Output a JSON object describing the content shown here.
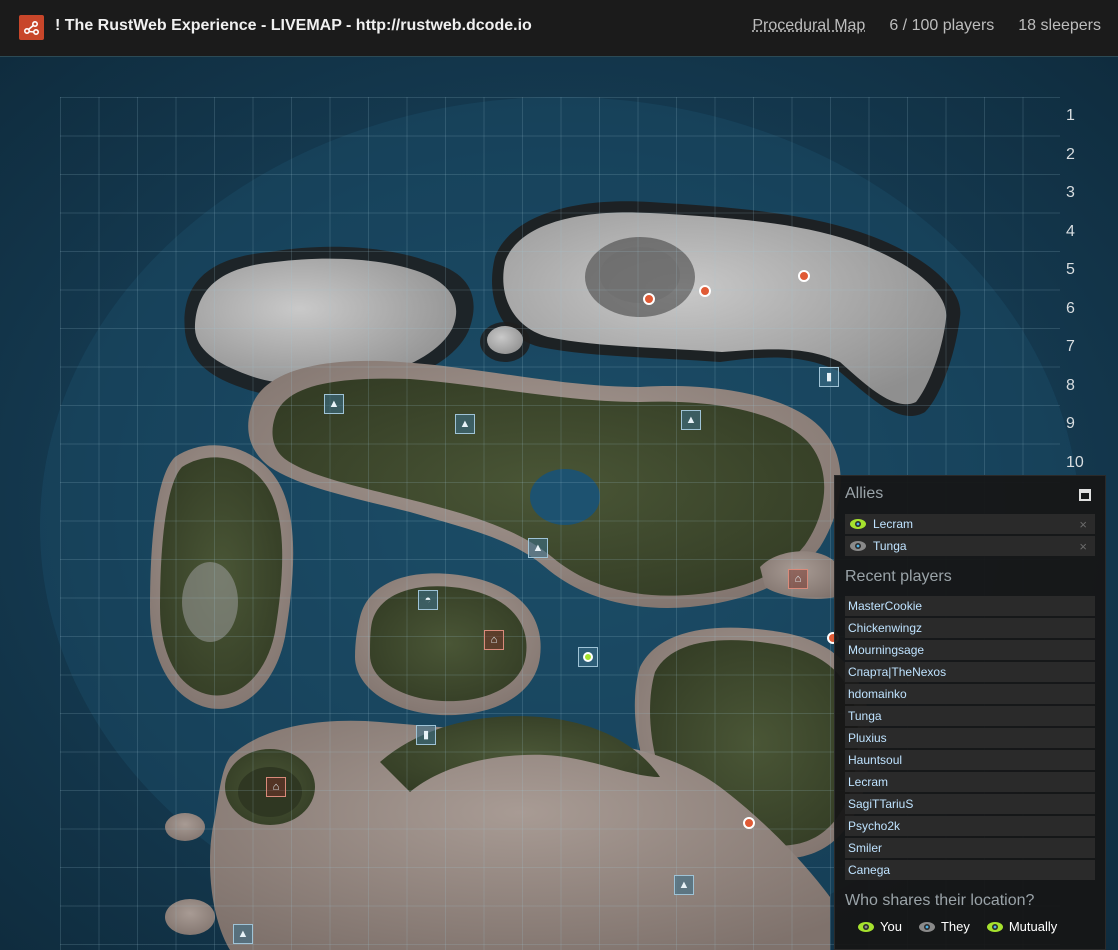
{
  "header": {
    "title": "! The RustWeb Experience - LIVEMAP - http://rustweb.dcode.io",
    "map_type": "Procedural Map",
    "players": "6 / 100 players",
    "sleepers": "18 sleepers"
  },
  "grid_rows": [
    "1",
    "2",
    "3",
    "4",
    "5",
    "6",
    "7",
    "8",
    "9",
    "10"
  ],
  "allies": {
    "heading": "Allies",
    "items": [
      {
        "name": "Lecram",
        "share": "mutually",
        "eye_color": "#a6e22e"
      },
      {
        "name": "Tunga",
        "share": "they",
        "eye_color": "#4fb3e8"
      }
    ],
    "remove_symbol": "×"
  },
  "recent": {
    "heading": "Recent players",
    "items": [
      "MasterCookie",
      "Chickenwingz",
      "Mourningsage",
      "Спарта|TheNexos",
      "hdomainko",
      "Tunga",
      "Pluxius",
      "Hauntsoul",
      "Lecram",
      "SagiTTariuS",
      "Psycho2k",
      "Smiler",
      "Canega"
    ]
  },
  "share": {
    "heading": "Who shares their location?",
    "legend": [
      {
        "label": "You",
        "color": "#a6e22e"
      },
      {
        "label": "They",
        "color": "#4fb3e8"
      },
      {
        "label": "Mutually",
        "color": "#a6e22e"
      }
    ]
  },
  "colors": {
    "header_bg": "#1b1b1b",
    "water": "#153b52",
    "snow": "#a9a9a9",
    "forest": "#3f4a2c",
    "sand": "#8c7e77",
    "player_dot": "#e05a35",
    "accent_logo": "#c8462a"
  },
  "icons": {
    "logo": "share-nodes-icon",
    "monument": "mountain-icon",
    "lighthouse": "lighthouse-icon",
    "satellite": "satellite-dish-icon",
    "house": "house-icon",
    "player": "player-dot-icon",
    "self": "self-location-icon"
  }
}
